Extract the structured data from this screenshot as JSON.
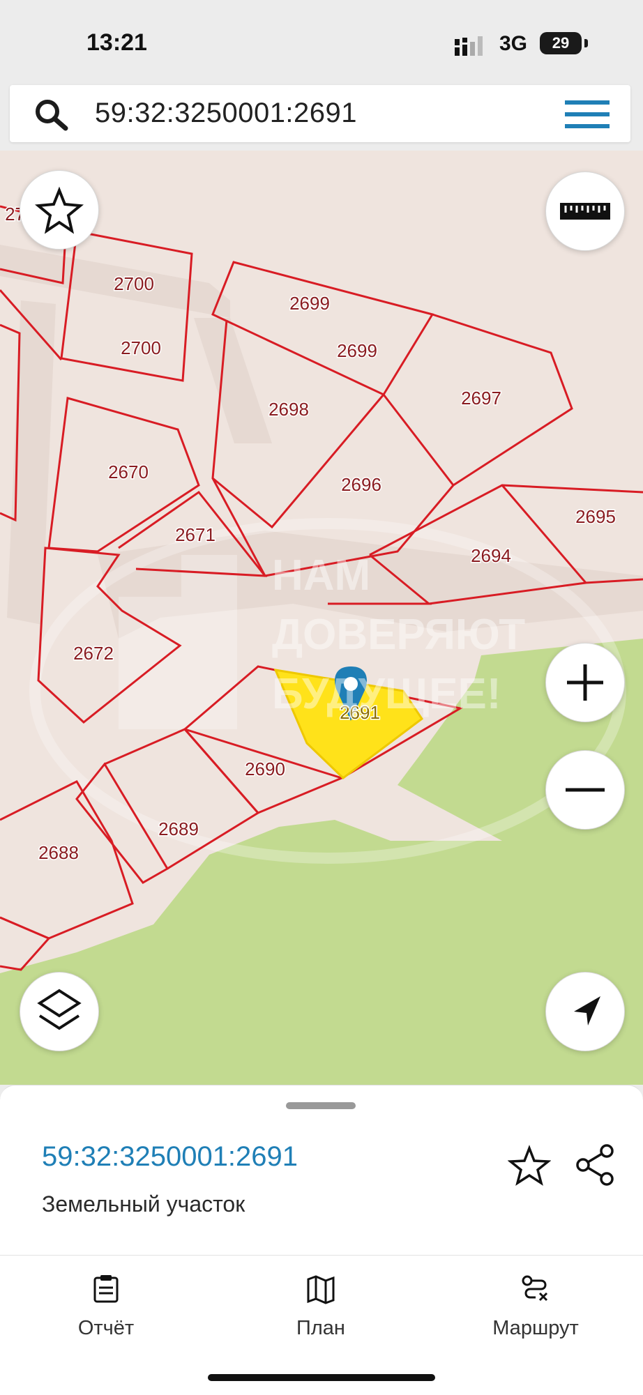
{
  "status": {
    "time": "13:21",
    "network": "3G",
    "battery": "29"
  },
  "search": {
    "query": "59:32:3250001:2691",
    "icon": "search-icon",
    "menu_icon": "hamburger-menu-icon"
  },
  "map": {
    "watermark_lines": [
      "НАМ",
      "ДОВЕРЯЮТ",
      "БУДУЩЕЕ!"
    ],
    "selected_parcel": "2691",
    "parcels": [
      "2701",
      "2700",
      "2700",
      "2699",
      "2699",
      "2697",
      "2698",
      "2696",
      "2695",
      "2694",
      "2670",
      "2671",
      "2672",
      "2690",
      "2689",
      "2688",
      "2691"
    ],
    "colors": {
      "background": "#efe4de",
      "road": "#e6d9d2",
      "forest": "#c2da90",
      "boundary": "#d81c24",
      "selected_fill": "#ffe21a",
      "pin": "#1f7fb6"
    },
    "buttons": {
      "favorite": "star-icon",
      "ruler": "ruler-icon",
      "zoom_in": "plus-icon",
      "zoom_out": "minus-icon",
      "layers": "layers-icon",
      "locate": "navigation-arrow-icon"
    }
  },
  "sheet": {
    "cadastral_number": "59:32:3250001:2691",
    "type": "Земельный участок"
  },
  "tabs": [
    {
      "label": "Отчёт",
      "icon": "clipboard-report-icon"
    },
    {
      "label": "План",
      "icon": "map-plan-icon"
    },
    {
      "label": "Маршрут",
      "icon": "route-icon"
    }
  ]
}
